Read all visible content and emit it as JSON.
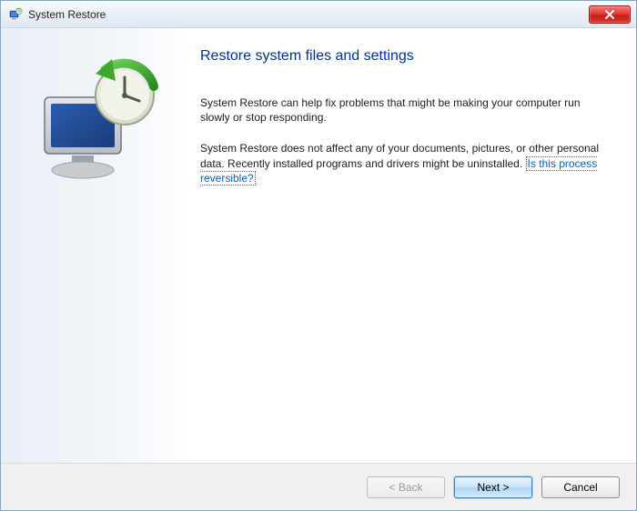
{
  "titlebar": {
    "title": "System Restore"
  },
  "main": {
    "heading": "Restore system files and settings",
    "para1": "System Restore can help fix problems that might be making your computer run slowly or stop responding.",
    "para2_prefix": "System Restore does not affect any of your documents, pictures, or other personal data. Recently installed programs and drivers might be uninstalled. ",
    "link_text": "Is this process reversible?"
  },
  "footer": {
    "back": "< Back",
    "next": "Next >",
    "cancel": "Cancel"
  }
}
